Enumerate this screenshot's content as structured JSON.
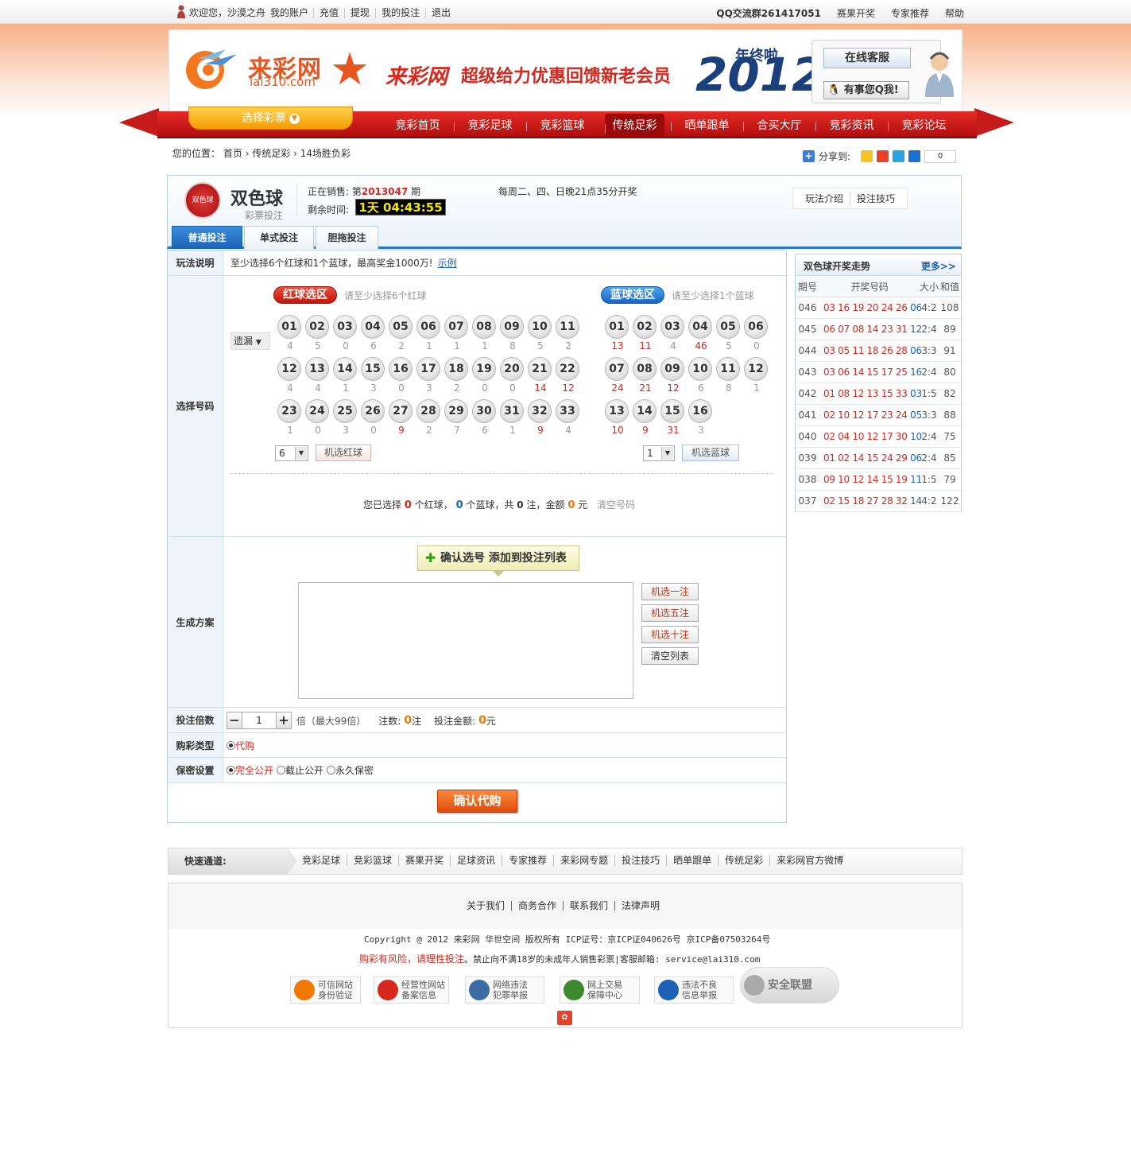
{
  "topbar": {
    "welcome": "欢迎您，沙漠之舟",
    "links": [
      "我的账户",
      "充值",
      "提现",
      "我的投注",
      "退出"
    ],
    "qq_group": "QQ交流群261417051",
    "right_links": [
      "赛果开奖",
      "专家推荐",
      "帮助"
    ]
  },
  "header": {
    "logo_text": "来彩网",
    "logo_url": "lai310.com",
    "banner_brand": "来彩网",
    "banner_text": "超级给力优惠回馈新老会员",
    "banner_year": "2012",
    "banner_tag": "年终啦",
    "service_btn": "在线客服",
    "qq_btn": "有事您Q我!"
  },
  "nav": {
    "select_lottery": "选择彩票",
    "items": [
      "竞彩首页",
      "竞彩足球",
      "竞彩篮球",
      "传统足彩",
      "晒单跟单",
      "合买大厅",
      "竞彩资讯",
      "竞彩论坛"
    ],
    "active": "传统足彩"
  },
  "breadcrumb": {
    "prefix": "您的位置：",
    "items": [
      "首页",
      "传统足彩",
      "14场胜负彩"
    ]
  },
  "share": {
    "label": "分享到:",
    "count": "0"
  },
  "lottery": {
    "name": "双色球",
    "sub": "彩票投注",
    "logo_text": "双色球",
    "onsale_prefix": "正在销售: 第",
    "issue": "2013047",
    "onsale_suffix": "期",
    "remain_label": "剩余时间:",
    "timer": "1天 04:43:55",
    "draw_info": "每周二、四、日晚21点35分开奖",
    "help_links": [
      "玩法介绍",
      "投注技巧"
    ],
    "tabs": [
      "普通投注",
      "单式投注",
      "胆拖投注"
    ]
  },
  "form": {
    "labels": {
      "rule": "玩法说明",
      "select": "选择号码",
      "plan": "生成方案",
      "multiple": "投注倍数",
      "buytype": "购彩类型",
      "secret": "保密设置"
    },
    "rule_text": "至少选择6个红球和1个蓝球，最高奖金1000万!",
    "rule_link": "示例",
    "red_zone": "红球选区",
    "red_tip": "请至少选择6个红球",
    "blue_zone": "蓝球选区",
    "blue_tip": "请至少选择1个蓝球",
    "omit_label": "遗漏",
    "red_balls": [
      "01",
      "02",
      "03",
      "04",
      "05",
      "06",
      "07",
      "08",
      "09",
      "10",
      "11",
      "12",
      "13",
      "14",
      "15",
      "16",
      "17",
      "18",
      "19",
      "20",
      "21",
      "22",
      "23",
      "24",
      "25",
      "26",
      "27",
      "28",
      "29",
      "30",
      "31",
      "32",
      "33"
    ],
    "red_omit": [
      "4",
      "5",
      "0",
      "6",
      "2",
      "1",
      "1",
      "1",
      "8",
      "5",
      "2",
      "4",
      "4",
      "1",
      "3",
      "0",
      "3",
      "2",
      "0",
      "0",
      "14",
      "12",
      "1",
      "0",
      "3",
      "0",
      "9",
      "2",
      "7",
      "6",
      "1",
      "9",
      "4"
    ],
    "blue_balls": [
      "01",
      "02",
      "03",
      "04",
      "05",
      "06",
      "07",
      "08",
      "09",
      "10",
      "11",
      "12",
      "13",
      "14",
      "15",
      "16"
    ],
    "blue_omit": [
      "13",
      "11",
      "4",
      "46",
      "5",
      "0",
      "24",
      "21",
      "12",
      "6",
      "8",
      "1",
      "10",
      "9",
      "31",
      "3"
    ],
    "red_count": "6",
    "red_random_btn": "机选红球",
    "blue_count": "1",
    "blue_random_btn": "机选蓝球",
    "summary": {
      "p1": "您已选择",
      "red": "0",
      "p2": "个红球，",
      "blue": "0",
      "p3": "个蓝球，共",
      "bets": "0",
      "p4": "注，金额",
      "amount": "0",
      "p5": "元",
      "clear": "清空号码"
    },
    "confirm_btn": "确认选号 添加到投注列表",
    "side_btns": [
      "机选一注",
      "机选五注",
      "机选十注",
      "清空列表"
    ],
    "multiple_value": "1",
    "multiple_unit": "倍（最大99倍）",
    "bets_label": "注数:",
    "bets_value": "0",
    "bets_unit": "注",
    "amount_label": "投注金额:",
    "amount_value": "0",
    "amount_unit": "元",
    "buytype_option": "代购",
    "secret_options": [
      "完全公开",
      "截止公开",
      "永久保密"
    ],
    "buy_btn": "确认代购"
  },
  "trend": {
    "title": "双色球开奖走势",
    "more": "更多>>",
    "headers": [
      "期号",
      "开奖号码",
      "大小",
      "和值"
    ],
    "rows": [
      {
        "issue": "046",
        "red": "03 16 19 20 24 26",
        "blue": "06",
        "size": "4:2",
        "sum": "108"
      },
      {
        "issue": "045",
        "red": "06 07 08 14 23 31",
        "blue": "12",
        "size": "2:4",
        "sum": "89"
      },
      {
        "issue": "044",
        "red": "03 05 11 18 26 28",
        "blue": "06",
        "size": "3:3",
        "sum": "91"
      },
      {
        "issue": "043",
        "red": "03 06 14 15 17 25",
        "blue": "16",
        "size": "2:4",
        "sum": "80"
      },
      {
        "issue": "042",
        "red": "01 08 12 13 15 33",
        "blue": "03",
        "size": "1:5",
        "sum": "82"
      },
      {
        "issue": "041",
        "red": "02 10 12 17 23 24",
        "blue": "05",
        "size": "3:3",
        "sum": "88"
      },
      {
        "issue": "040",
        "red": "02 04 10 12 17 30",
        "blue": "10",
        "size": "2:4",
        "sum": "75"
      },
      {
        "issue": "039",
        "red": "01 02 14 15 24 29",
        "blue": "06",
        "size": "2:4",
        "sum": "85"
      },
      {
        "issue": "038",
        "red": "09 10 12 14 15 19",
        "blue": "11",
        "size": "1:5",
        "sum": "79"
      },
      {
        "issue": "037",
        "red": "02 15 18 27 28 32",
        "blue": "14",
        "size": "4:2",
        "sum": "122"
      }
    ]
  },
  "quick": {
    "title": "快速通道:",
    "items": [
      "竞彩足球",
      "竞彩篮球",
      "赛果开奖",
      "足球资讯",
      "专家推荐",
      "来彩网专题",
      "投注技巧",
      "晒单跟单",
      "传统足彩",
      "来彩网官方微博"
    ]
  },
  "footer": {
    "links": [
      "关于我们",
      "商务合作",
      "联系我们",
      "法律声明"
    ],
    "copyright": "Copyright @ 2012 来彩网 华世空间 版权所有 ICP证号：京ICP证040626号 京ICP备07503264号",
    "risk": "购彩有风险，请理性投注",
    "notice": "。禁止向不满18岁的未成年人销售彩票|客服邮箱: service@lai310.com",
    "badges": [
      {
        "line1": "可信网站",
        "line2": "身份验证"
      },
      {
        "line1": "经营性网站",
        "line2": "备案信息"
      },
      {
        "line1": "网络违法",
        "line2": "犯罪举报"
      },
      {
        "line1": "网上交易",
        "line2": "保障中心"
      },
      {
        "line1": "违法不良",
        "line2": "信息举报"
      },
      {
        "line1": "安全联盟",
        "line2": ""
      }
    ]
  },
  "colors": {
    "red": "#d7261c",
    "blue": "#1b62b7",
    "nav_red": "#c61b1a",
    "orange": "#f07800"
  }
}
